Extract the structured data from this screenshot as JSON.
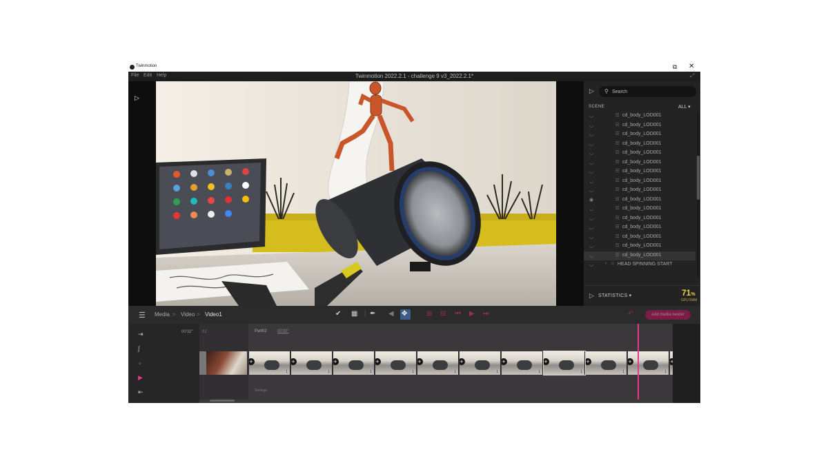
{
  "window": {
    "app_name": "Twinmotion",
    "title": "Twinmotion 2022.2.1 - challenge 9 v3_2022.2.1*"
  },
  "menu": [
    "File",
    "Edit",
    "Help"
  ],
  "right_panel": {
    "search_placeholder": "Search",
    "scene_label": "SCENE",
    "filter_value": "ALL",
    "items": [
      {
        "name": "cd_body_LOD001",
        "type": "mesh"
      },
      {
        "name": "cd_body_LOD001",
        "type": "mesh"
      },
      {
        "name": "cd_body_LOD001",
        "type": "mesh"
      },
      {
        "name": "cd_body_LOD001",
        "type": "mesh"
      },
      {
        "name": "cd_body_LOD001",
        "type": "mesh"
      },
      {
        "name": "cd_body_LOD001",
        "type": "mesh"
      },
      {
        "name": "cd_body_LOD001",
        "type": "mesh"
      },
      {
        "name": "cd_body_LOD001",
        "type": "mesh"
      },
      {
        "name": "cd_body_LOD001",
        "type": "mesh"
      },
      {
        "name": "cd_body_LOD001",
        "type": "mesh"
      },
      {
        "name": "cd_body_LOD001",
        "type": "mesh"
      },
      {
        "name": "cd_body_LOD001",
        "type": "mesh"
      },
      {
        "name": "cd_body_LOD001",
        "type": "mesh"
      },
      {
        "name": "cd_body_LOD001",
        "type": "mesh"
      },
      {
        "name": "cd_body_LOD001",
        "type": "mesh"
      },
      {
        "name": "cd_body_LOD001",
        "type": "mesh"
      },
      {
        "name": "HEAD SPINNING START",
        "type": "folder"
      }
    ],
    "statistics_label": "STATISTICS",
    "gpu_value": "71",
    "gpu_unit": "%",
    "gpu_label": "GPU RAM"
  },
  "toolbar": {
    "breadcrumb": [
      "Media",
      "Video",
      "Video1"
    ],
    "export_label": "Add media render"
  },
  "timeline": {
    "time_start": "00'32\"",
    "first_clip_time": "01'",
    "part_label": "Part02",
    "part_time": "00'30\"",
    "settings_label": "Settings",
    "clip_count_label": "1"
  },
  "colors": {
    "accent_pink": "#e6378b",
    "gpu_yellow": "#e8d24a",
    "export_button": "#7a1d45",
    "selected_tool": "#3c5d8a"
  },
  "icons": {
    "play": "play-icon",
    "search": "search-icon",
    "eye": "eye-icon",
    "grid": "grid-icon",
    "move": "move-icon",
    "undo": "undo-icon"
  }
}
